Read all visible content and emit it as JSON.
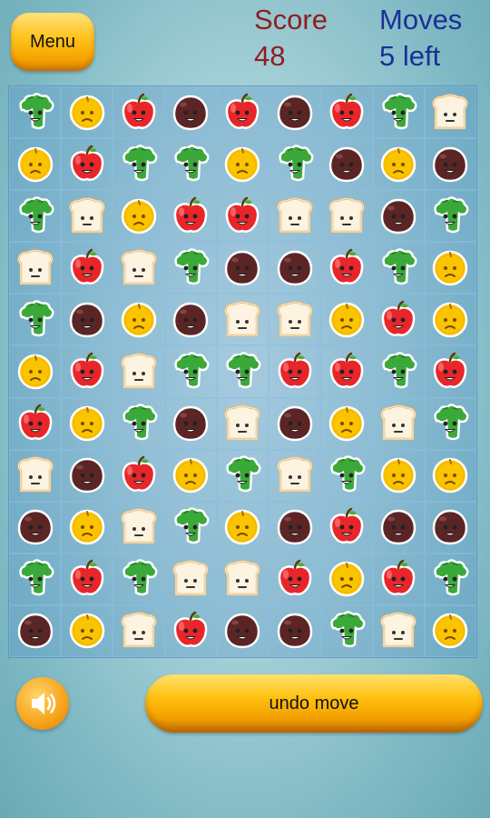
{
  "header": {
    "menu_label": "Menu",
    "score_label": "Score",
    "score_value": "48",
    "moves_label": "Moves",
    "moves_value": "5 left"
  },
  "board": {
    "rows": [
      [
        "broccoli",
        "orange",
        "apple",
        "chestnut",
        "apple",
        "chestnut",
        "apple",
        "broccoli",
        "bread"
      ],
      [
        "orange",
        "apple",
        "broccoli",
        "broccoli",
        "orange",
        "broccoli",
        "chestnut",
        "orange",
        "chestnut"
      ],
      [
        "broccoli",
        "bread",
        "orange",
        "apple",
        "apple",
        "bread",
        "bread",
        "chestnut",
        "broccoli"
      ],
      [
        "bread",
        "apple",
        "bread",
        "broccoli",
        "chestnut",
        "chestnut",
        "apple",
        "broccoli",
        "orange"
      ],
      [
        "broccoli",
        "chestnut",
        "orange",
        "chestnut",
        "bread",
        "bread",
        "orange",
        "apple",
        "orange"
      ],
      [
        "orange",
        "apple",
        "bread",
        "broccoli",
        "broccoli",
        "apple",
        "apple",
        "broccoli",
        "apple"
      ],
      [
        "apple",
        "orange",
        "broccoli",
        "chestnut",
        "bread",
        "chestnut",
        "orange",
        "bread",
        "broccoli"
      ],
      [
        "bread",
        "chestnut",
        "apple",
        "orange",
        "broccoli",
        "bread",
        "broccoli",
        "orange",
        "orange"
      ],
      [
        "chestnut",
        "orange",
        "bread",
        "broccoli",
        "orange",
        "chestnut",
        "apple",
        "chestnut",
        "chestnut"
      ],
      [
        "broccoli",
        "apple",
        "broccoli",
        "bread",
        "bread",
        "apple",
        "orange",
        "apple",
        "broccoli"
      ],
      [
        "chestnut",
        "orange",
        "bread",
        "apple",
        "chestnut",
        "chestnut",
        "broccoli",
        "bread",
        "orange"
      ]
    ]
  },
  "footer": {
    "sound_icon": "speaker-icon",
    "undo_label": "undo move"
  },
  "colors": {
    "button_gold": "#ffc21a",
    "score_color": "#8e1f1f",
    "moves_color": "#1b2f96"
  }
}
